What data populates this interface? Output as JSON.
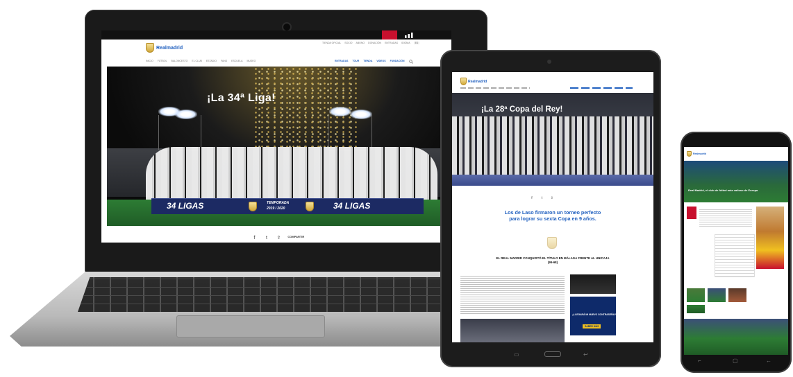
{
  "laptop": {
    "brand": "Realmadrid",
    "top_links": [
      "TIENDA OFICIAL",
      "SOCIO",
      "ABONO",
      "DONACIÓN",
      "ENTRADAS",
      "IDIOMA",
      "ES"
    ],
    "nav_items": [
      "INICIO",
      "FÚTBOL",
      "BALONCESTO",
      "EL CLUB",
      "ESTADIO",
      "FANS",
      "ESCUELA",
      "MUSEO"
    ],
    "nav_right": [
      "ENTRADAS",
      "TOUR",
      "TIENDA",
      "VIDEOS",
      "FUNDACIÓN"
    ],
    "hero_title": "¡La 34ª Liga!",
    "banner_left": "34 LIGAS",
    "banner_mid_line1": "TEMPORADA",
    "banner_mid_line2": "2019 / 2020",
    "banner_right": "34 LIGAS",
    "share_label": "COMPARTIR"
  },
  "tablet": {
    "brand": "Realmadrid",
    "hero_title": "¡La 28ª Copa del Rey!",
    "headline": "Los de Laso firmaron un torneo perfecto para lograr su sexta Copa en 9 años.",
    "subheadline": "EL REAL MADRID CONQUISTÓ EL TÍTULO EN MÁLAGA FRENTE AL UNICAJA (95-68)",
    "ad_title": "¿LLEGARÁ MI NUEVO CONTRASEÑA?",
    "ad_button": "SABER MÁS"
  },
  "phone": {
    "brand": "Realmadrid",
    "hero_text": "Real Madrid, el club de fútbol más valioso de Europa"
  },
  "icons": [
    "facebook-icon",
    "twitter-icon",
    "share-icon",
    "camera-icon",
    "search-icon",
    "home-button-icon",
    "back-icon",
    "recent-apps-icon"
  ]
}
